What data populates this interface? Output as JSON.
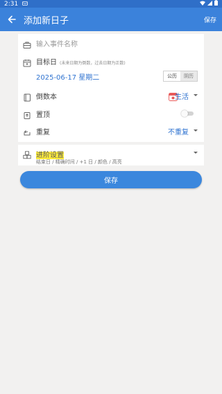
{
  "status_bar": {
    "time": "2:31"
  },
  "app_bar": {
    "title": "添加新日子",
    "save_label": "保存"
  },
  "form": {
    "event_name_placeholder": "输入事件名称",
    "target_date_label": "目标日",
    "target_date_hint": "(未来日期为倒数，过去日期为正数)",
    "date_value": "2025-06-17 星期二",
    "calendar_solar": "公历",
    "calendar_lunar": "阴历",
    "book_label": "倒数本",
    "book_value": "生活",
    "pin_label": "置顶",
    "repeat_label": "重复",
    "repeat_value": "不重复"
  },
  "advanced": {
    "title": "进阶设置",
    "subtitle": "结束日 / 精确时间 / +1 日 / 颜色 / 高亮"
  },
  "save_button": {
    "label": "保存"
  },
  "colors": {
    "accent": "#3b82db",
    "status": "#2f6fc8",
    "highlight": "#ffec3d",
    "book_icon": "#e85a5a"
  }
}
